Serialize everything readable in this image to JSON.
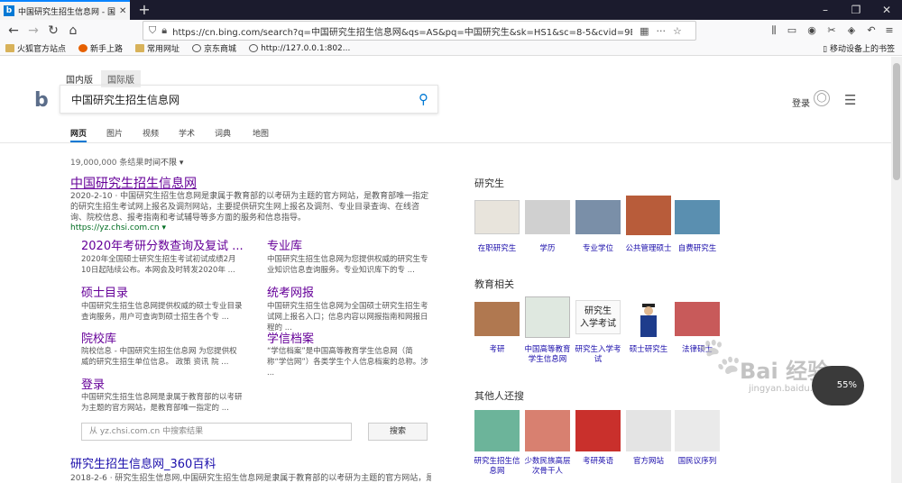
{
  "browser": {
    "tab_title": "中国研究生招生信息网 - 国内版",
    "tab_favicon": "b",
    "url": "https://cn.bing.com/search?q=中国研究生招生信息网&qs=AS&pq=中国研究生&sk=HS1&sc=8-5&cvid=9B8C688928",
    "bookmarks": [
      "火狐官方站点",
      "新手上路",
      "常用网址",
      "京东商城",
      "http://127.0.0.1:802..."
    ],
    "bookmarks_right": "移动设备上的书签"
  },
  "bing": {
    "logo": "b",
    "region_tabs": [
      "国内版",
      "国际版"
    ],
    "query": "中国研究生招生信息网",
    "login": "登录",
    "scopes": [
      "网页",
      "图片",
      "视频",
      "学术",
      "词典",
      "地图"
    ],
    "result_count": "19,000,000 条结果",
    "time_filter": "时间不限 ▾"
  },
  "result1": {
    "title": "中国研究生招生信息网",
    "snippet": "2020-2-10 · 中国研究生招生信息网是隶属于教育部的以考研为主题的官方网站，是教育部唯一指定的研究生招生考试网上报名及调剂网站，主要提供研究生网上报名及调剂、专业目录查询、在线咨询、院校信息、报考指南和考试辅导等多方面的服务和信息指导。",
    "url": "https://yz.chsi.com.cn ▾",
    "sublinks": [
      {
        "title": "2020年考研分数查询及复试 ...",
        "snippet": "2020年全国硕士研究生招生考试初试成绩2月10日起陆续公布。本网会及时转发2020年 ..."
      },
      {
        "title": "专业库",
        "snippet": "中国研究生招生信息网为您提供权威的研究生专业知识信息查询服务。专业知识库下的专 ..."
      },
      {
        "title": "硕士目录",
        "snippet": "中国研究生招生信息网提供权威的硕士专业目录查询服务，用户可查询到硕士招生各个专 ..."
      },
      {
        "title": "统考网报",
        "snippet": "中国研究生招生信息网为全国硕士研究生招生考试网上报名入口；信息内容以网报指南和网报日程的 ..."
      },
      {
        "title": "院校库",
        "snippet": "院校信息 - 中国研究生招生信息网 为您提供权威的研究生招生单位信息。 政策 资讯 院 ..."
      },
      {
        "title": "学信档案",
        "snippet": "“学信档案”是中国高等教育学生信息网（简称“学信网”）各类学生个人信息档案的总称。涉 ..."
      },
      {
        "title": "登录",
        "snippet": "中国研究生招生信息网是隶属于教育部的以考研为主题的官方网站，是教育部唯一指定的 ..."
      }
    ],
    "site_search_placeholder": "从 yz.chsi.com.cn 中搜索结果",
    "site_search_button": "搜索"
  },
  "result2": {
    "title": "研究生招生信息网_360百科",
    "snippet": "2018-2-6 · 研究生招生信息网,中国研究生招生信息网是隶属于教育部的以考研为主题的官方网站，是教育"
  },
  "sidebar": {
    "sections": [
      {
        "title": "研究生",
        "items": [
          "在职研究生",
          "学历",
          "专业学位",
          "公共管理硕士",
          "自费研究生"
        ]
      },
      {
        "title": "教育相关",
        "items": [
          "考研",
          "中国高等教育学生信息网",
          "研究生入学考试",
          "硕士研究生",
          "法律硕士"
        ]
      },
      {
        "title": "其他人还搜",
        "items": [
          "研究生招生信息网",
          "少数民族高层次骨干人",
          "考研英语",
          "官方网站",
          "国民议序列"
        ]
      }
    ]
  },
  "watermark": {
    "brand": "Bai 经验",
    "domain": "jingyan.baidu.com"
  },
  "gauge": "55%",
  "colors": {
    "bing_blue": "#0078d4",
    "visited_link": "#660099",
    "link": "#1a0dab",
    "url_green": "#006d21"
  }
}
